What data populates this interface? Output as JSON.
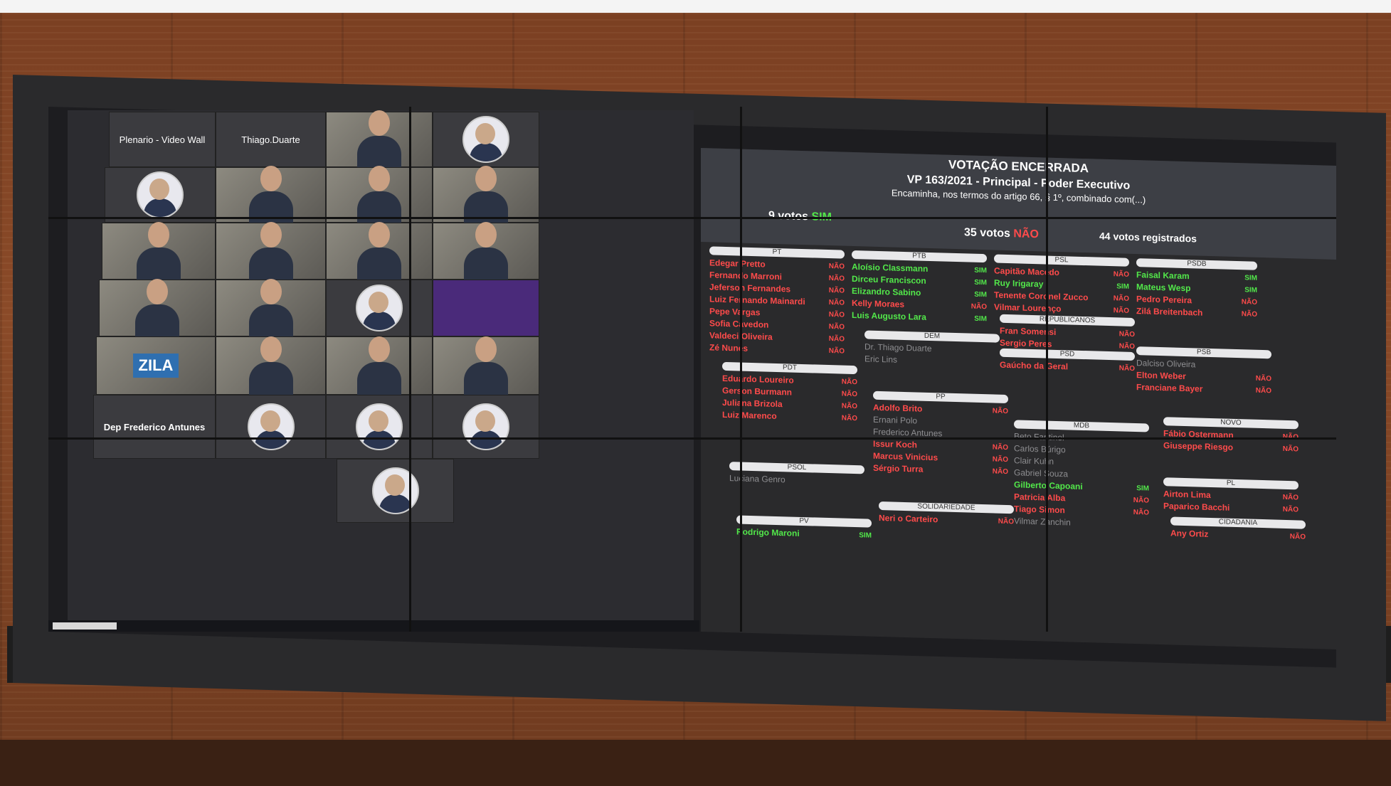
{
  "wall": {
    "tile_plenario": "Plenario - Video Wall",
    "tile_thiago": "Thiago.Duarte",
    "tile_frederico": "Dep Frederico Antunes",
    "zila_banner": "ZILA"
  },
  "vote": {
    "title": "VOTAÇÃO ENCERRADA",
    "subtitle": "VP 163/2021 - Principal - Poder Executivo",
    "description": "Encaminha, nos termos do artigo 66, § 1º, combinado com(...)",
    "sim_count": "9 votos",
    "sim_label": "SIM",
    "nao_count": "35 votos",
    "nao_label": "NÃO",
    "registered": "44 votos registrados"
  },
  "parties": {
    "pt": {
      "name": "PT",
      "members": [
        {
          "n": "Edegar Pretto",
          "v": "NÃO"
        },
        {
          "n": "Fernando Marroni",
          "v": "NÃO"
        },
        {
          "n": "Jeferson Fernandes",
          "v": "NÃO"
        },
        {
          "n": "Luiz Fernando Mainardi",
          "v": "NÃO"
        },
        {
          "n": "Pepe Vargas",
          "v": "NÃO"
        },
        {
          "n": "Sofia Cavedon",
          "v": "NÃO"
        },
        {
          "n": "Valdeci Oliveira",
          "v": "NÃO"
        },
        {
          "n": "Zé Nunes",
          "v": "NÃO"
        }
      ]
    },
    "ptb": {
      "name": "PTB",
      "members": [
        {
          "n": "Aloísio Classmann",
          "v": "SIM"
        },
        {
          "n": "Dirceu Franciscon",
          "v": "SIM"
        },
        {
          "n": "Elizandro Sabino",
          "v": "SIM"
        },
        {
          "n": "Kelly Moraes",
          "v": "NÃO"
        },
        {
          "n": "Luis Augusto Lara",
          "v": "SIM"
        }
      ]
    },
    "psl": {
      "name": "PSL",
      "members": [
        {
          "n": "Capitão Macedo",
          "v": "NÃO"
        },
        {
          "n": "Ruy Irigaray",
          "v": "SIM"
        },
        {
          "n": "Tenente Coronel Zucco",
          "v": "NÃO"
        },
        {
          "n": "Vilmar Lourenço",
          "v": "NÃO"
        }
      ]
    },
    "psdb": {
      "name": "PSDB",
      "members": [
        {
          "n": "Faisal Karam",
          "v": "SIM"
        },
        {
          "n": "Mateus Wesp",
          "v": "SIM"
        },
        {
          "n": "Pedro Pereira",
          "v": "NÃO"
        },
        {
          "n": "Zilá Breitenbach",
          "v": "NÃO"
        }
      ]
    },
    "republicanos": {
      "name": "REPUBLICANOS",
      "members": [
        {
          "n": "Fran Somensi",
          "v": "NÃO"
        },
        {
          "n": "Sergio Peres",
          "v": "NÃO"
        }
      ]
    },
    "dem": {
      "name": "DEM",
      "members": [
        {
          "n": "Dr. Thiago Duarte",
          "v": ""
        },
        {
          "n": "Eric Lins",
          "v": ""
        }
      ]
    },
    "psd": {
      "name": "PSD",
      "members": [
        {
          "n": "Gaúcho da Geral",
          "v": "NÃO"
        }
      ]
    },
    "psb": {
      "name": "PSB",
      "members": [
        {
          "n": "Dalciso Oliveira",
          "v": ""
        },
        {
          "n": "Elton Weber",
          "v": "NÃO"
        },
        {
          "n": "Franciane Bayer",
          "v": "NÃO"
        }
      ]
    },
    "pdt": {
      "name": "PDT",
      "members": [
        {
          "n": "Eduardo Loureiro",
          "v": "NÃO"
        },
        {
          "n": "Gerson Burmann",
          "v": "NÃO"
        },
        {
          "n": "Juliana Brizola",
          "v": "NÃO"
        },
        {
          "n": "Luiz Marenco",
          "v": "NÃO"
        }
      ]
    },
    "pp": {
      "name": "PP",
      "members": [
        {
          "n": "Adolfo Brito",
          "v": "NÃO"
        },
        {
          "n": "Ernani Polo",
          "v": ""
        },
        {
          "n": "Frederico Antunes",
          "v": ""
        },
        {
          "n": "Issur Koch",
          "v": "NÃO"
        },
        {
          "n": "Marcus Vinicius",
          "v": "NÃO"
        },
        {
          "n": "Sérgio Turra",
          "v": "NÃO"
        }
      ]
    },
    "mdb": {
      "name": "MDB",
      "members": [
        {
          "n": "Beto Fantinel",
          "v": ""
        },
        {
          "n": "Carlos Búrigo",
          "v": ""
        },
        {
          "n": "Clair Kuhn",
          "v": ""
        },
        {
          "n": "Gabriel Souza",
          "v": ""
        },
        {
          "n": "Gilberto Capoani",
          "v": "SIM"
        },
        {
          "n": "Patricia Alba",
          "v": "NÃO"
        },
        {
          "n": "Tiago Simon",
          "v": "NÃO"
        },
        {
          "n": "Vilmar Zanchin",
          "v": ""
        }
      ]
    },
    "novo": {
      "name": "NOVO",
      "members": [
        {
          "n": "Fábio Ostermann",
          "v": "NÃO"
        },
        {
          "n": "Giuseppe Riesgo",
          "v": "NÃO"
        }
      ]
    },
    "pl": {
      "name": "PL",
      "members": [
        {
          "n": "Airton Lima",
          "v": "NÃO"
        },
        {
          "n": "Paparico Bacchi",
          "v": "NÃO"
        }
      ]
    },
    "psol": {
      "name": "PSOL",
      "members": [
        {
          "n": "Luciana Genro",
          "v": ""
        }
      ]
    },
    "solidariedade": {
      "name": "SOLIDARIEDADE",
      "members": [
        {
          "n": "Neri o Carteiro",
          "v": "NÃO"
        }
      ]
    },
    "pv": {
      "name": "PV",
      "members": [
        {
          "n": "Rodrigo Maroni",
          "v": "SIM"
        }
      ]
    },
    "cidadania": {
      "name": "CIDADANIA",
      "members": [
        {
          "n": "Any Ortiz",
          "v": "NÃO"
        }
      ]
    }
  },
  "colors": {
    "sim": "#52e84a",
    "nao": "#ff4b4b",
    "absent": "#8d8d90"
  }
}
